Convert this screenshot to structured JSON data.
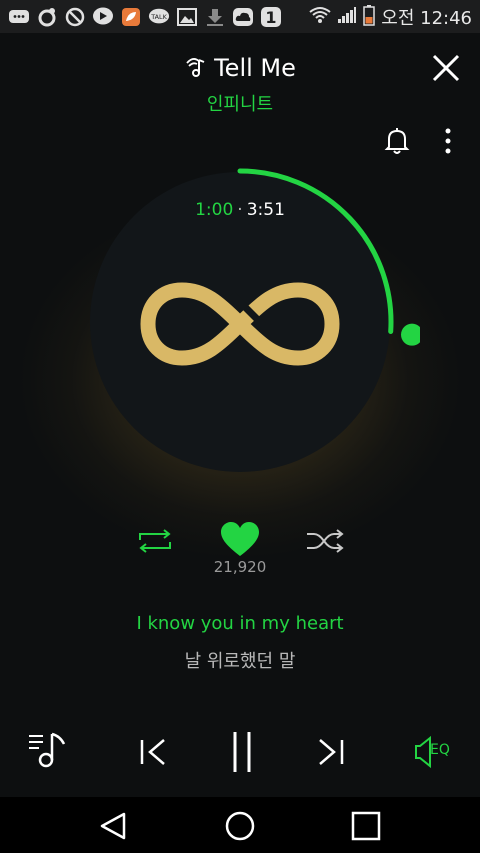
{
  "status_bar": {
    "time": "오전 12:46",
    "icons": [
      "chat-icon",
      "loop-icon",
      "block-icon",
      "play-store-icon",
      "leaf-icon",
      "talk-icon",
      "image-icon",
      "download-icon",
      "cloud-icon",
      "number-icon",
      "wifi-icon",
      "signal-icon",
      "battery-icon"
    ],
    "badge": "1",
    "talk": "TALK"
  },
  "player": {
    "song_title": "Tell Me",
    "artist": "인피니트",
    "current_time": "1:00",
    "separator": "·",
    "total_time": "3:51",
    "progress": 0.26,
    "like_count": "21,920",
    "lyrics": {
      "current": "I know you in my heart",
      "next": "날 위로했던 말"
    },
    "eq_label": "EQ"
  },
  "colors": {
    "accent": "#23d443",
    "logo_gold": "#d9b866",
    "disc": "#121619",
    "background": "#0d0f10"
  }
}
